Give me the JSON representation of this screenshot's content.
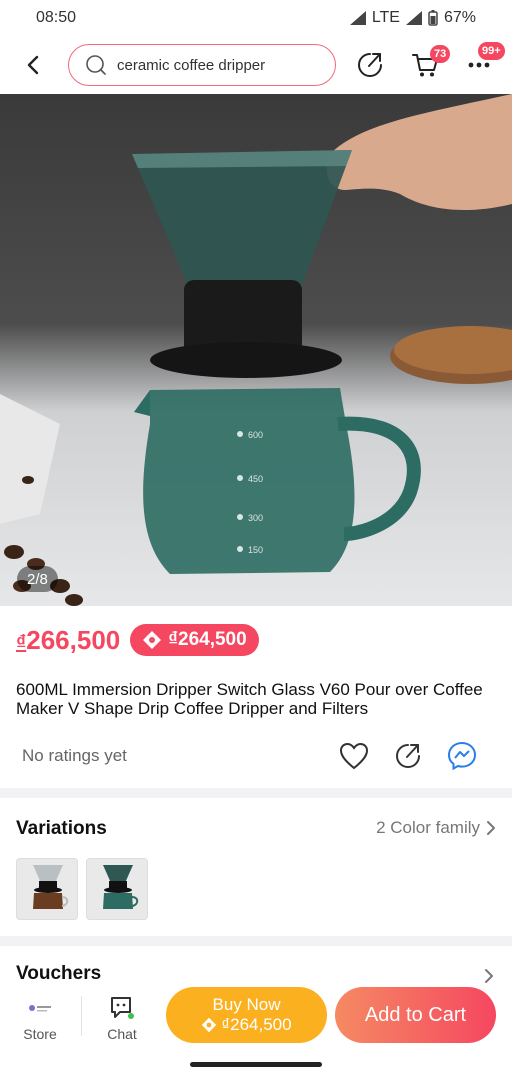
{
  "status_bar": {
    "time": "08:50",
    "network": "LTE",
    "battery": "67%"
  },
  "top_bar": {
    "search_text": "ceramic coffee dripper",
    "cart_badge": "73",
    "more_badge": "99+"
  },
  "gallery": {
    "counter": "2/8"
  },
  "product": {
    "price": "266,500",
    "currency": "₫",
    "voucher_price": "₫264,500",
    "title": "600ML Immersion Dripper Switch Glass V60 Pour over Coffee Maker V Shape Drip Coffee Dripper and Filters",
    "ratings_text": "No ratings yet",
    "image_scale_marks": [
      "600",
      "450",
      "300",
      "150"
    ]
  },
  "variations": {
    "title": "Variations",
    "link_text": "2 Color family"
  },
  "vouchers": {
    "title": "Vouchers"
  },
  "bottom_bar": {
    "store_label": "Store",
    "chat_label": "Chat",
    "buy_now_label": "Buy Now",
    "buy_now_price": "₫264,500",
    "add_to_cart_label": "Add to Cart"
  },
  "colors": {
    "accent": "#f5475f",
    "buy_now": "#fbb01f",
    "search_border": "#f06a7c"
  }
}
